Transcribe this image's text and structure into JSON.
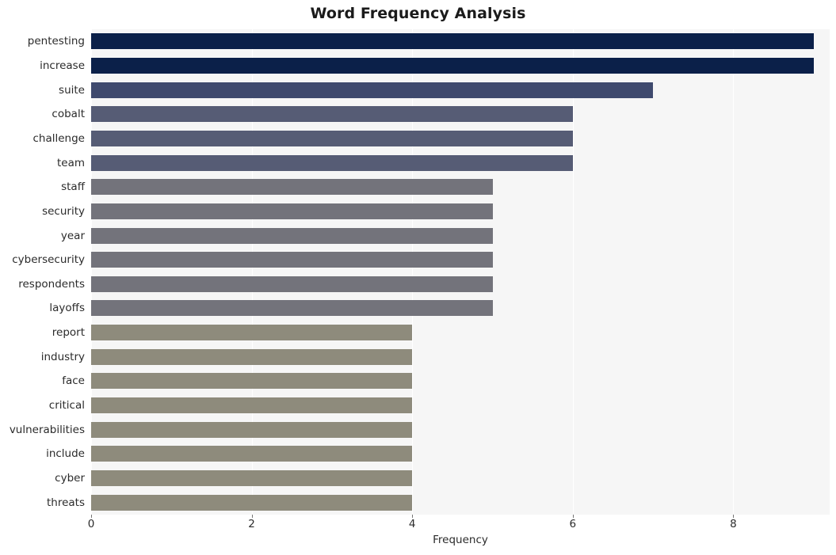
{
  "chart_data": {
    "type": "bar",
    "orientation": "horizontal",
    "title": "Word Frequency Analysis",
    "xlabel": "Frequency",
    "ylabel": "",
    "xlim": [
      0,
      9.2
    ],
    "xticks": [
      0,
      2,
      4,
      6,
      8
    ],
    "grid": true,
    "grid_axis": "x",
    "legend": null,
    "categories": [
      "pentesting",
      "increase",
      "suite",
      "cobalt",
      "challenge",
      "team",
      "staff",
      "security",
      "year",
      "cybersecurity",
      "respondents",
      "layoffs",
      "report",
      "industry",
      "face",
      "critical",
      "vulnerabilities",
      "include",
      "cyber",
      "threats"
    ],
    "values": [
      9,
      9,
      7,
      6,
      6,
      6,
      5,
      5,
      5,
      5,
      5,
      5,
      4,
      4,
      4,
      4,
      4,
      4,
      4,
      4
    ],
    "bar_colors": [
      "#0b2049",
      "#0b2049",
      "#3f4a6e",
      "#565c75",
      "#565c75",
      "#565c75",
      "#73737b",
      "#73737b",
      "#73737b",
      "#73737b",
      "#73737b",
      "#73737b",
      "#8e8b7c",
      "#8e8b7c",
      "#8e8b7c",
      "#8e8b7c",
      "#8e8b7c",
      "#8e8b7c",
      "#8e8b7c",
      "#8e8b7c"
    ],
    "plot_background": "#f6f6f6",
    "gridline_color": "#ffffff",
    "figure_background": "#ffffff"
  }
}
